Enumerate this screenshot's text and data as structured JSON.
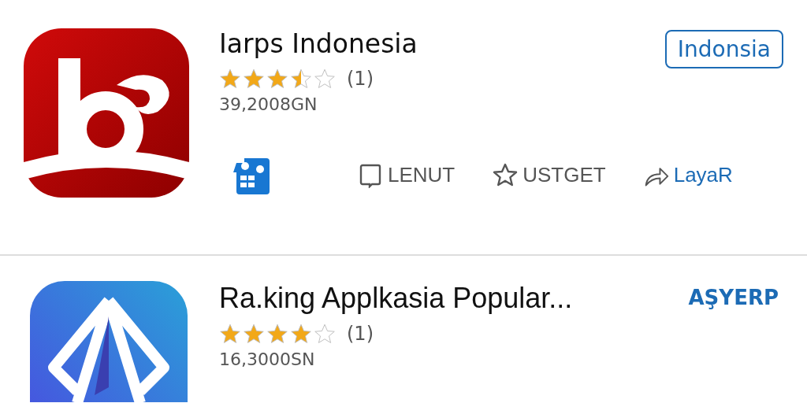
{
  "apps": [
    {
      "title": "Iarps Indonesia",
      "stars": 3.5,
      "rating_count": "(1)",
      "downloads": "39,2008GN",
      "action": {
        "kind": "outlined",
        "label": "Indonsia"
      },
      "toolbar": [
        {
          "kind": "comment",
          "label": "LENUT"
        },
        {
          "kind": "star",
          "label": "USTGET"
        },
        {
          "kind": "share",
          "label": "LayaR"
        }
      ]
    },
    {
      "title": "Ra.king Applkasia Popular...",
      "stars": 4,
      "rating_count": "(1)",
      "downloads": "16,3000SN",
      "action": {
        "kind": "text",
        "label": "AŞYERP"
      }
    }
  ]
}
